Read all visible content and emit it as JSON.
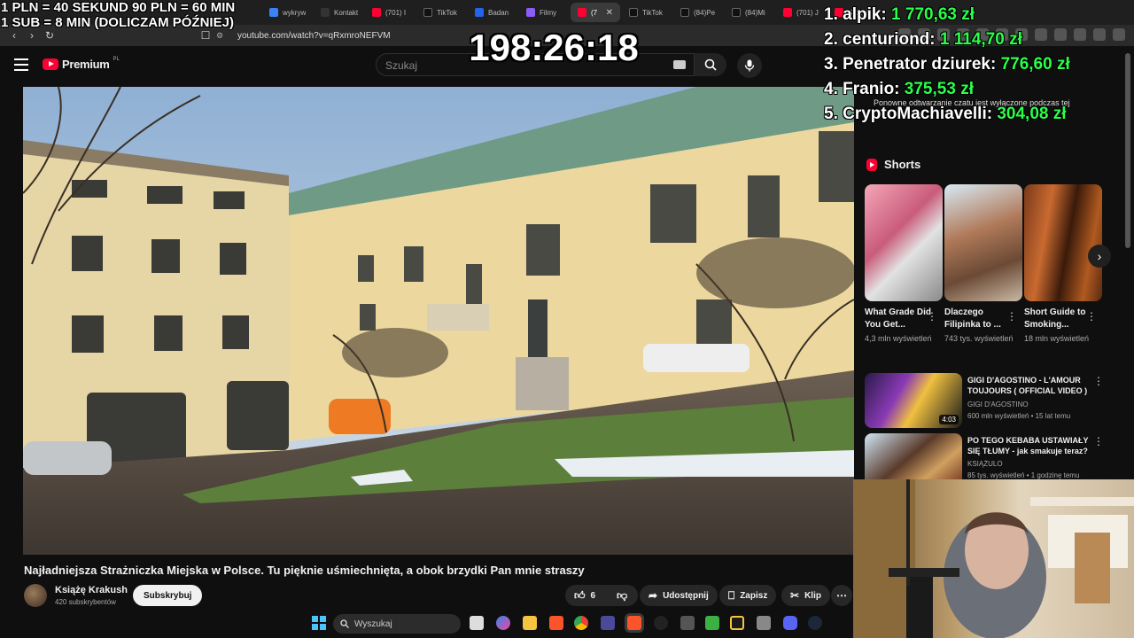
{
  "browser": {
    "tabs": [
      {
        "label": "wykryw",
        "color": "#3b82f6"
      },
      {
        "label": "Kontakt",
        "color": "#333333"
      },
      {
        "label": "(701) I",
        "color": "#ff0033"
      },
      {
        "label": "TikTok",
        "color": "#111111"
      },
      {
        "label": "Badan",
        "color": "#2563eb"
      },
      {
        "label": "Filmy",
        "color": "#8b5cf6"
      },
      {
        "label": "(7",
        "color": "#ff0033",
        "active": true
      },
      {
        "label": "TikTok",
        "color": "#111111"
      },
      {
        "label": "(84)Pe",
        "color": "#111111"
      },
      {
        "label": "(84)Mi",
        "color": "#111111"
      },
      {
        "label": "(701) J",
        "color": "#ff0033"
      },
      {
        "label": "(701) I",
        "color": "#ff0033"
      }
    ],
    "url": "youtube.com/watch?v=qRxmroNEFVM"
  },
  "youtube": {
    "logo_text": "Premium",
    "region": "PL",
    "search_placeholder": "Szukaj",
    "video_title": "Najładniejsza Strażniczka Miejska w Polsce. Tu pięknie uśmiechnięta, a obok brzydki Pan mnie straszy",
    "channel": {
      "name": "Książę Krakush",
      "subscribers": "420 subskrybentów"
    },
    "subscribe_label": "Subskrybuj",
    "actions": {
      "likes": "6",
      "share": "Udostępnij",
      "save": "Zapisz",
      "clip": "Klip"
    },
    "chat_notice": "Ponowne odtwarzanie czatu jest wyłączone podczas tej",
    "shorts_label": "Shorts",
    "shorts": [
      {
        "title": "What Grade Did You Get...",
        "views": "4,3 mln wyświetleń"
      },
      {
        "title": "Dlaczego Filipinka to ...",
        "views": "743 tys. wyświetleń"
      },
      {
        "title": "Short Guide to Smoking...",
        "views": "18 mln wyświetleń"
      }
    ],
    "recommended": [
      {
        "title": "GIGI D'AGOSTINO - L'AMOUR TOUJOURS ( OFFICIAL VIDEO )",
        "channel": "GIGI D'AGOSTINO",
        "meta": "600 mln wyświetleń • 15 lat temu",
        "duration": "4:03"
      },
      {
        "title": "PO TEGO KEBABA USTAWIAŁY SIĘ TŁUMY - jak smakuje teraz?",
        "channel": "KSIĄŻULO",
        "meta": "85 tys. wyświetleń • 1 godzinę temu"
      }
    ]
  },
  "taskbar": {
    "search_placeholder": "Wyszukaj"
  },
  "overlay": {
    "rules_line1": "1 PLN =  40 SEKUND 90 PLN = 60 MIN",
    "rules_line2": "1 SUB = 8 MIN (DOLICZAM PÓŹNIEJ)",
    "timer": "198:26:18",
    "leaderboard": [
      {
        "name": "1. alpik:",
        "amount": "1 770,63 zł"
      },
      {
        "name": "2. centuriond:",
        "amount": "1 114,70 zł"
      },
      {
        "name": "3. Penetrator dziurek:",
        "amount": "776,60 zł"
      },
      {
        "name": "4. Franio:",
        "amount": "375,53 zł"
      },
      {
        "name": "5. CryptoMachiavelli:",
        "amount": "304,08 zł"
      }
    ]
  },
  "colors": {
    "accent_red": "#ff0033",
    "donation_green": "#2bff4a"
  }
}
